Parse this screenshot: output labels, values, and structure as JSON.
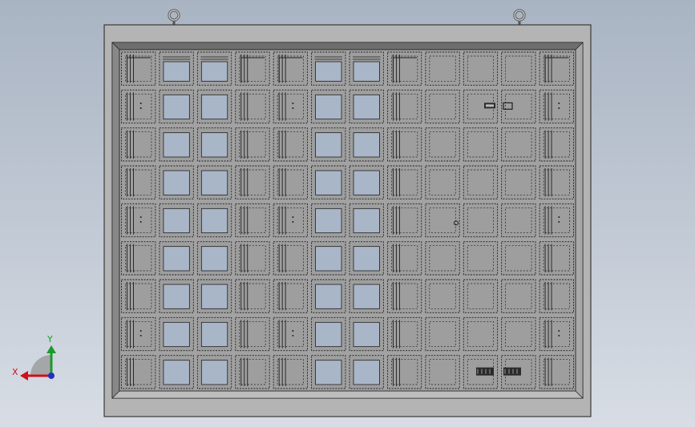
{
  "viewport": {
    "background_top": "#a9b4c3",
    "background_bottom": "#d8dde5"
  },
  "model": {
    "frame_color": "#b4b4b4",
    "panel_color": "#a2a2a2",
    "cell_color": "#9e9e9e",
    "window_color": "#a9b6c8",
    "edge_color": "#1e1e1e",
    "grid_columns": 12,
    "grid_rows": 9,
    "lifting_eyes": 2
  },
  "triad": {
    "x_label": "X",
    "y_label": "Y",
    "x_color": "#d0101a",
    "y_color": "#1a9a2a",
    "z_color": "#2030c0"
  }
}
